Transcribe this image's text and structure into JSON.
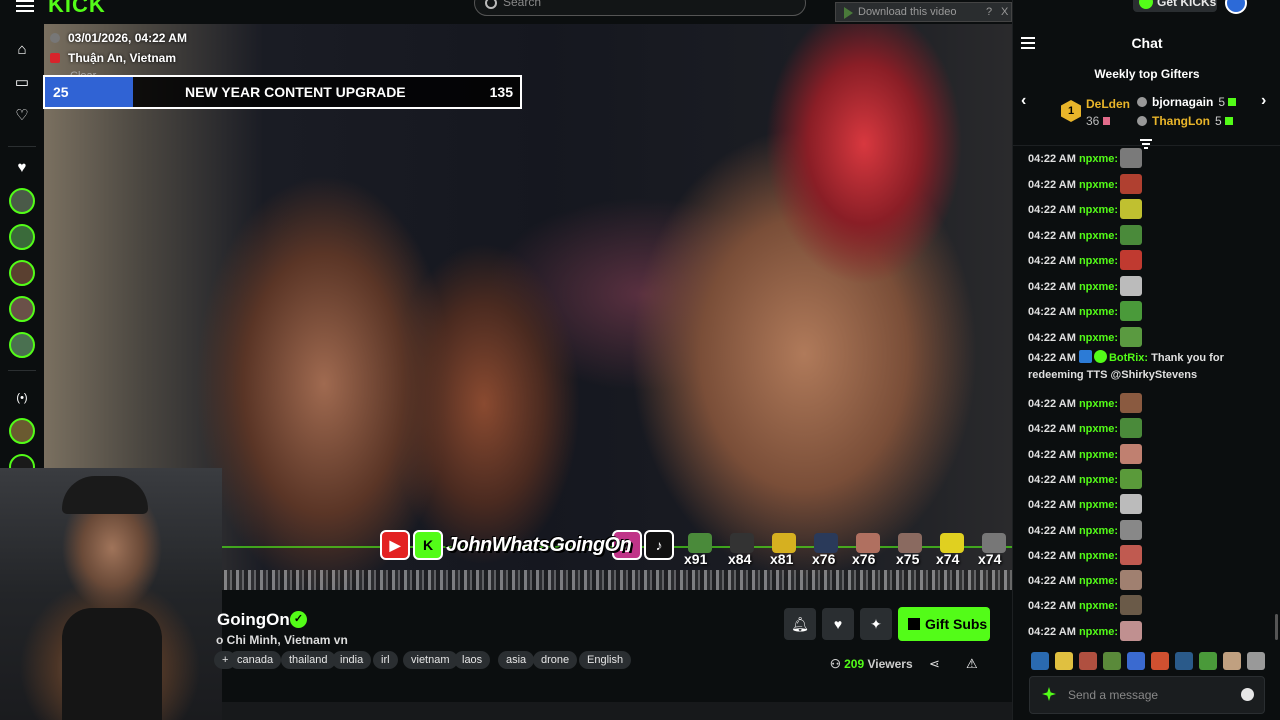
{
  "header": {
    "logo": "KICK",
    "search_placeholder": "Search",
    "download_label": "Download this video",
    "download_help": "?",
    "download_close": "X"
  },
  "stream_overlay": {
    "date": "03/01/2026, 04:22 AM",
    "location": "Thuận An, Vietnam",
    "clear_text": "Clear",
    "goal": {
      "current": "25",
      "title": "NEW YEAR CONTENT UPGRADE",
      "target": "135",
      "progress_fraction": 0.185
    },
    "handle": "JohnWhatsGoingOn",
    "emote_counts": [
      "x91",
      "x84",
      "x81",
      "x76",
      "x76",
      "x75",
      "x74",
      "x74"
    ]
  },
  "streamer": {
    "name": "GoingOn",
    "title": "o Chi Minh, Vietnam vn",
    "tags": [
      "+",
      "canada",
      "thailand",
      "india",
      "irl",
      "vietnam",
      "laos",
      "asia",
      "drone",
      "English"
    ],
    "viewers_count": "209",
    "viewers_label": "Viewers",
    "gift_label": "Gift Subs"
  },
  "chat": {
    "title": "Chat",
    "get_kicks": "Get KICKs",
    "gifters_title": "Weekly top Gifters",
    "top_gifter": {
      "rank": "1",
      "name": "DeLden",
      "count": "36"
    },
    "gifters": [
      {
        "name": "bjornagain",
        "count": "5",
        "color": "#ffffff"
      },
      {
        "name": "ThangLon",
        "count": "5",
        "color": "#e9b52a"
      }
    ],
    "messages": [
      {
        "time": "04:22 AM",
        "user": "npxme:"
      },
      {
        "time": "04:22 AM",
        "user": "npxme:"
      },
      {
        "time": "04:22 AM",
        "user": "npxme:"
      },
      {
        "time": "04:22 AM",
        "user": "npxme:"
      },
      {
        "time": "04:22 AM",
        "user": "npxme:"
      },
      {
        "time": "04:22 AM",
        "user": "npxme:"
      },
      {
        "time": "04:22 AM",
        "user": "npxme:"
      },
      {
        "time": "04:22 AM",
        "user": "npxme:"
      }
    ],
    "bot_message": {
      "time": "04:22 AM",
      "user": "BotRix:",
      "text": "Thank you for redeeming TTS @ShirkyStevens"
    },
    "messages_after": [
      {
        "time": "04:22 AM",
        "user": "npxme:"
      },
      {
        "time": "04:22 AM",
        "user": "npxme:"
      },
      {
        "time": "04:22 AM",
        "user": "npxme:"
      },
      {
        "time": "04:22 AM",
        "user": "npxme:"
      },
      {
        "time": "04:22 AM",
        "user": "npxme:"
      },
      {
        "time": "04:22 AM",
        "user": "npxme:"
      },
      {
        "time": "04:22 AM",
        "user": "npxme:"
      },
      {
        "time": "04:22 AM",
        "user": "npxme:"
      },
      {
        "time": "04:22 AM",
        "user": "npxme:"
      },
      {
        "time": "04:22 AM",
        "user": "npxme:"
      }
    ],
    "send_placeholder": "Send a message"
  },
  "colors": {
    "accent": "#53fc18",
    "background": "#0b0e0f",
    "goal_fill": "#3063d4"
  }
}
